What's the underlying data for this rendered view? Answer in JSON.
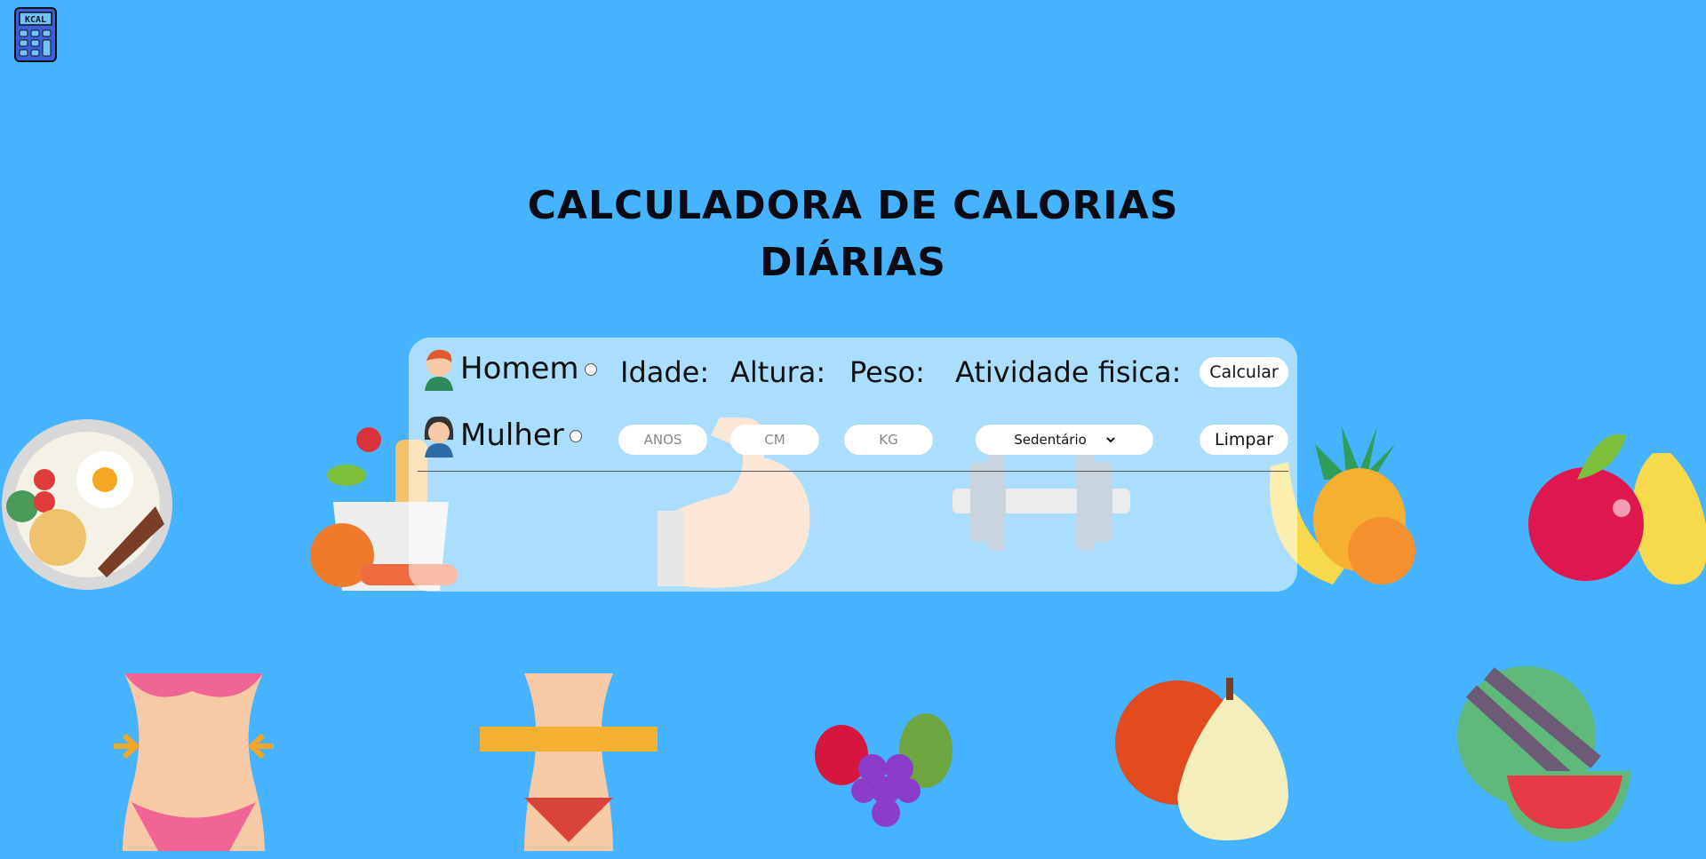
{
  "app": {
    "logo_icon": "kcal-calculator-icon",
    "title_line1": "CALCULADORA DE CALORIAS",
    "title_line2": "DIÁRIAS"
  },
  "form": {
    "gender_male": "Homem",
    "gender_female": "Mulher",
    "age_label": "Idade:",
    "height_label": "Altura:",
    "weight_label": "Peso:",
    "activity_label": "Atividade fisica:",
    "age_placeholder": "ANOS",
    "height_placeholder": "CM",
    "weight_placeholder": "KG",
    "activity_selected": "Sedentário",
    "calculate_button": "Calcular",
    "clear_button": "Limpar"
  },
  "colors": {
    "background": "#45b3ff",
    "panel": "rgba(255,255,255,0.55)"
  }
}
